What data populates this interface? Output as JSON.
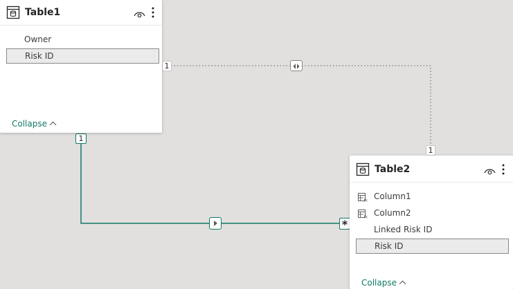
{
  "colors": {
    "canvas": "#e1e0df",
    "active_line": "#117865",
    "inactive_line": "#8a8886",
    "collapse_link": "#117865",
    "selected_field_bg": "#ebebeb"
  },
  "table1": {
    "title": "Table1",
    "icon": "table-icon",
    "fields": [
      {
        "label": "Owner",
        "icon": "",
        "selected": false
      },
      {
        "label": "Risk ID",
        "icon": "",
        "selected": true
      }
    ],
    "collapse_label": "Collapse"
  },
  "table2": {
    "title": "Table2",
    "icon": "table-icon",
    "fields": [
      {
        "label": "Column1",
        "icon": "calculated-column-icon",
        "selected": false
      },
      {
        "label": "Column2",
        "icon": "calculated-column-icon",
        "selected": false
      },
      {
        "label": "Linked Risk ID",
        "icon": "",
        "selected": false
      },
      {
        "label": "Risk ID",
        "icon": "",
        "selected": true
      }
    ],
    "collapse_label": "Collapse"
  },
  "relationships": {
    "inactive": {
      "from_cardinality": "1",
      "to_cardinality": "1",
      "direction": "both",
      "style": "dotted"
    },
    "active": {
      "from_cardinality": "1",
      "to_cardinality": "*",
      "direction": "single",
      "style": "solid"
    }
  }
}
